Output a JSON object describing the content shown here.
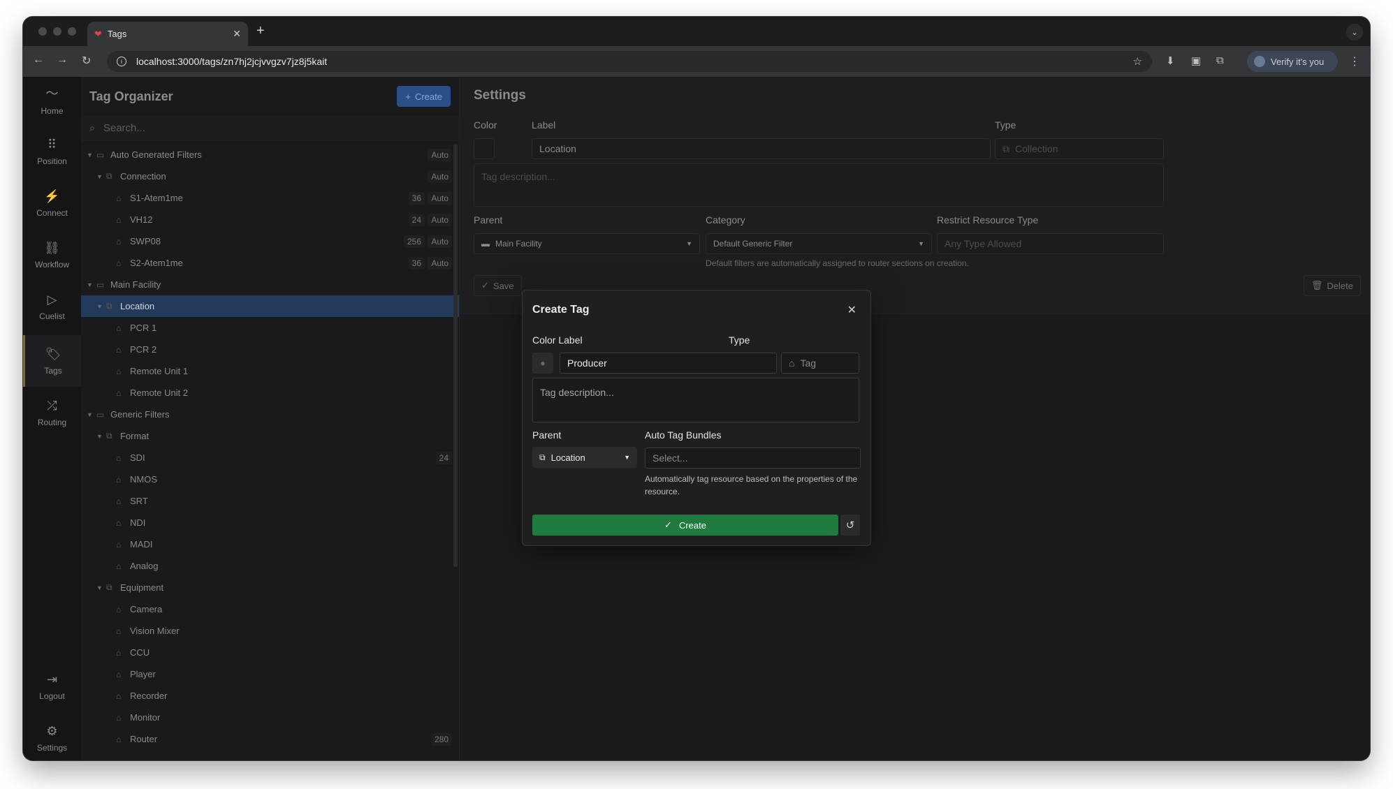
{
  "browser": {
    "tab_title": "Tags",
    "url": "localhost:3000/tags/zn7hj2jcjvvgzv7jz8j5kait",
    "verify_label": "Verify it's you"
  },
  "rail": {
    "items": [
      {
        "label": "Home",
        "icon": "home-icon"
      },
      {
        "label": "Position",
        "icon": "grid-icon"
      },
      {
        "label": "Connect",
        "icon": "plug-icon"
      },
      {
        "label": "Workflow",
        "icon": "workflow-icon"
      },
      {
        "label": "Cuelist",
        "icon": "play-icon"
      },
      {
        "label": "Tags",
        "icon": "tag-icon",
        "active": true
      },
      {
        "label": "Routing",
        "icon": "shuffle-icon"
      }
    ],
    "bottom": [
      {
        "label": "Logout",
        "icon": "logout-icon"
      },
      {
        "label": "Settings",
        "icon": "gear-icon"
      }
    ]
  },
  "tree": {
    "title": "Tag Organizer",
    "create_label": "Create",
    "search_placeholder": "Search...",
    "rows": [
      {
        "label": "Auto Generated Filters",
        "level": 0,
        "kind": "folder",
        "expanded": true,
        "auto": "Auto"
      },
      {
        "label": "Connection",
        "level": 1,
        "kind": "collection",
        "expanded": true,
        "auto": "Auto"
      },
      {
        "label": "S1-Atem1me",
        "level": 2,
        "kind": "tag",
        "count": "36",
        "auto": "Auto"
      },
      {
        "label": "VH12",
        "level": 2,
        "kind": "tag",
        "count": "24",
        "auto": "Auto"
      },
      {
        "label": "SWP08",
        "level": 2,
        "kind": "tag",
        "count": "256",
        "auto": "Auto"
      },
      {
        "label": "S2-Atem1me",
        "level": 2,
        "kind": "tag",
        "count": "36",
        "auto": "Auto"
      },
      {
        "label": "Main Facility",
        "level": 0,
        "kind": "folder",
        "expanded": true
      },
      {
        "label": "Location",
        "level": 1,
        "kind": "collection",
        "expanded": true,
        "selected": true
      },
      {
        "label": "PCR 1",
        "level": 2,
        "kind": "tag"
      },
      {
        "label": "PCR 2",
        "level": 2,
        "kind": "tag"
      },
      {
        "label": "Remote Unit 1",
        "level": 2,
        "kind": "tag"
      },
      {
        "label": "Remote Unit 2",
        "level": 2,
        "kind": "tag"
      },
      {
        "label": "Generic Filters",
        "level": 0,
        "kind": "folder",
        "expanded": true
      },
      {
        "label": "Format",
        "level": 1,
        "kind": "collection",
        "expanded": true
      },
      {
        "label": "SDI",
        "level": 2,
        "kind": "tag",
        "count": "24"
      },
      {
        "label": "NMOS",
        "level": 2,
        "kind": "tag"
      },
      {
        "label": "SRT",
        "level": 2,
        "kind": "tag"
      },
      {
        "label": "NDI",
        "level": 2,
        "kind": "tag"
      },
      {
        "label": "MADI",
        "level": 2,
        "kind": "tag"
      },
      {
        "label": "Analog",
        "level": 2,
        "kind": "tag"
      },
      {
        "label": "Equipment",
        "level": 1,
        "kind": "collection",
        "expanded": true
      },
      {
        "label": "Camera",
        "level": 2,
        "kind": "tag"
      },
      {
        "label": "Vision Mixer",
        "level": 2,
        "kind": "tag"
      },
      {
        "label": "CCU",
        "level": 2,
        "kind": "tag"
      },
      {
        "label": "Player",
        "level": 2,
        "kind": "tag"
      },
      {
        "label": "Recorder",
        "level": 2,
        "kind": "tag"
      },
      {
        "label": "Monitor",
        "level": 2,
        "kind": "tag"
      },
      {
        "label": "Router",
        "level": 2,
        "kind": "tag",
        "count": "280"
      }
    ]
  },
  "settings": {
    "title": "Settings",
    "color_label": "Color",
    "label_label": "Label",
    "label_value": "Location",
    "type_label": "Type",
    "type_value": "Collection",
    "desc_placeholder": "Tag description...",
    "parent_label": "Parent",
    "parent_value": "Main Facility",
    "category_label": "Category",
    "category_value": "Default Generic Filter",
    "category_note": "Default filters are automatically assigned to router sections on creation.",
    "restrict_label": "Restrict Resource Type",
    "restrict_placeholder": "Any Type Allowed",
    "save_label": "Save",
    "delete_label": "Delete"
  },
  "dialog": {
    "title": "Create Tag",
    "color_label_heading": "Color Label",
    "type_heading": "Type",
    "name_value": "Producer",
    "type_value": "Tag",
    "desc_placeholder": "Tag description...",
    "parent_heading": "Parent",
    "parent_value": "Location",
    "bundles_heading": "Auto Tag Bundles",
    "bundles_placeholder": "Select...",
    "bundles_note": "Automatically tag resource based on the properties of the resource.",
    "create_label": "Create"
  },
  "colors": {
    "accent_blue": "#2c4e86",
    "create_green": "#1f7a3e",
    "selected_row": "#243a5a"
  }
}
